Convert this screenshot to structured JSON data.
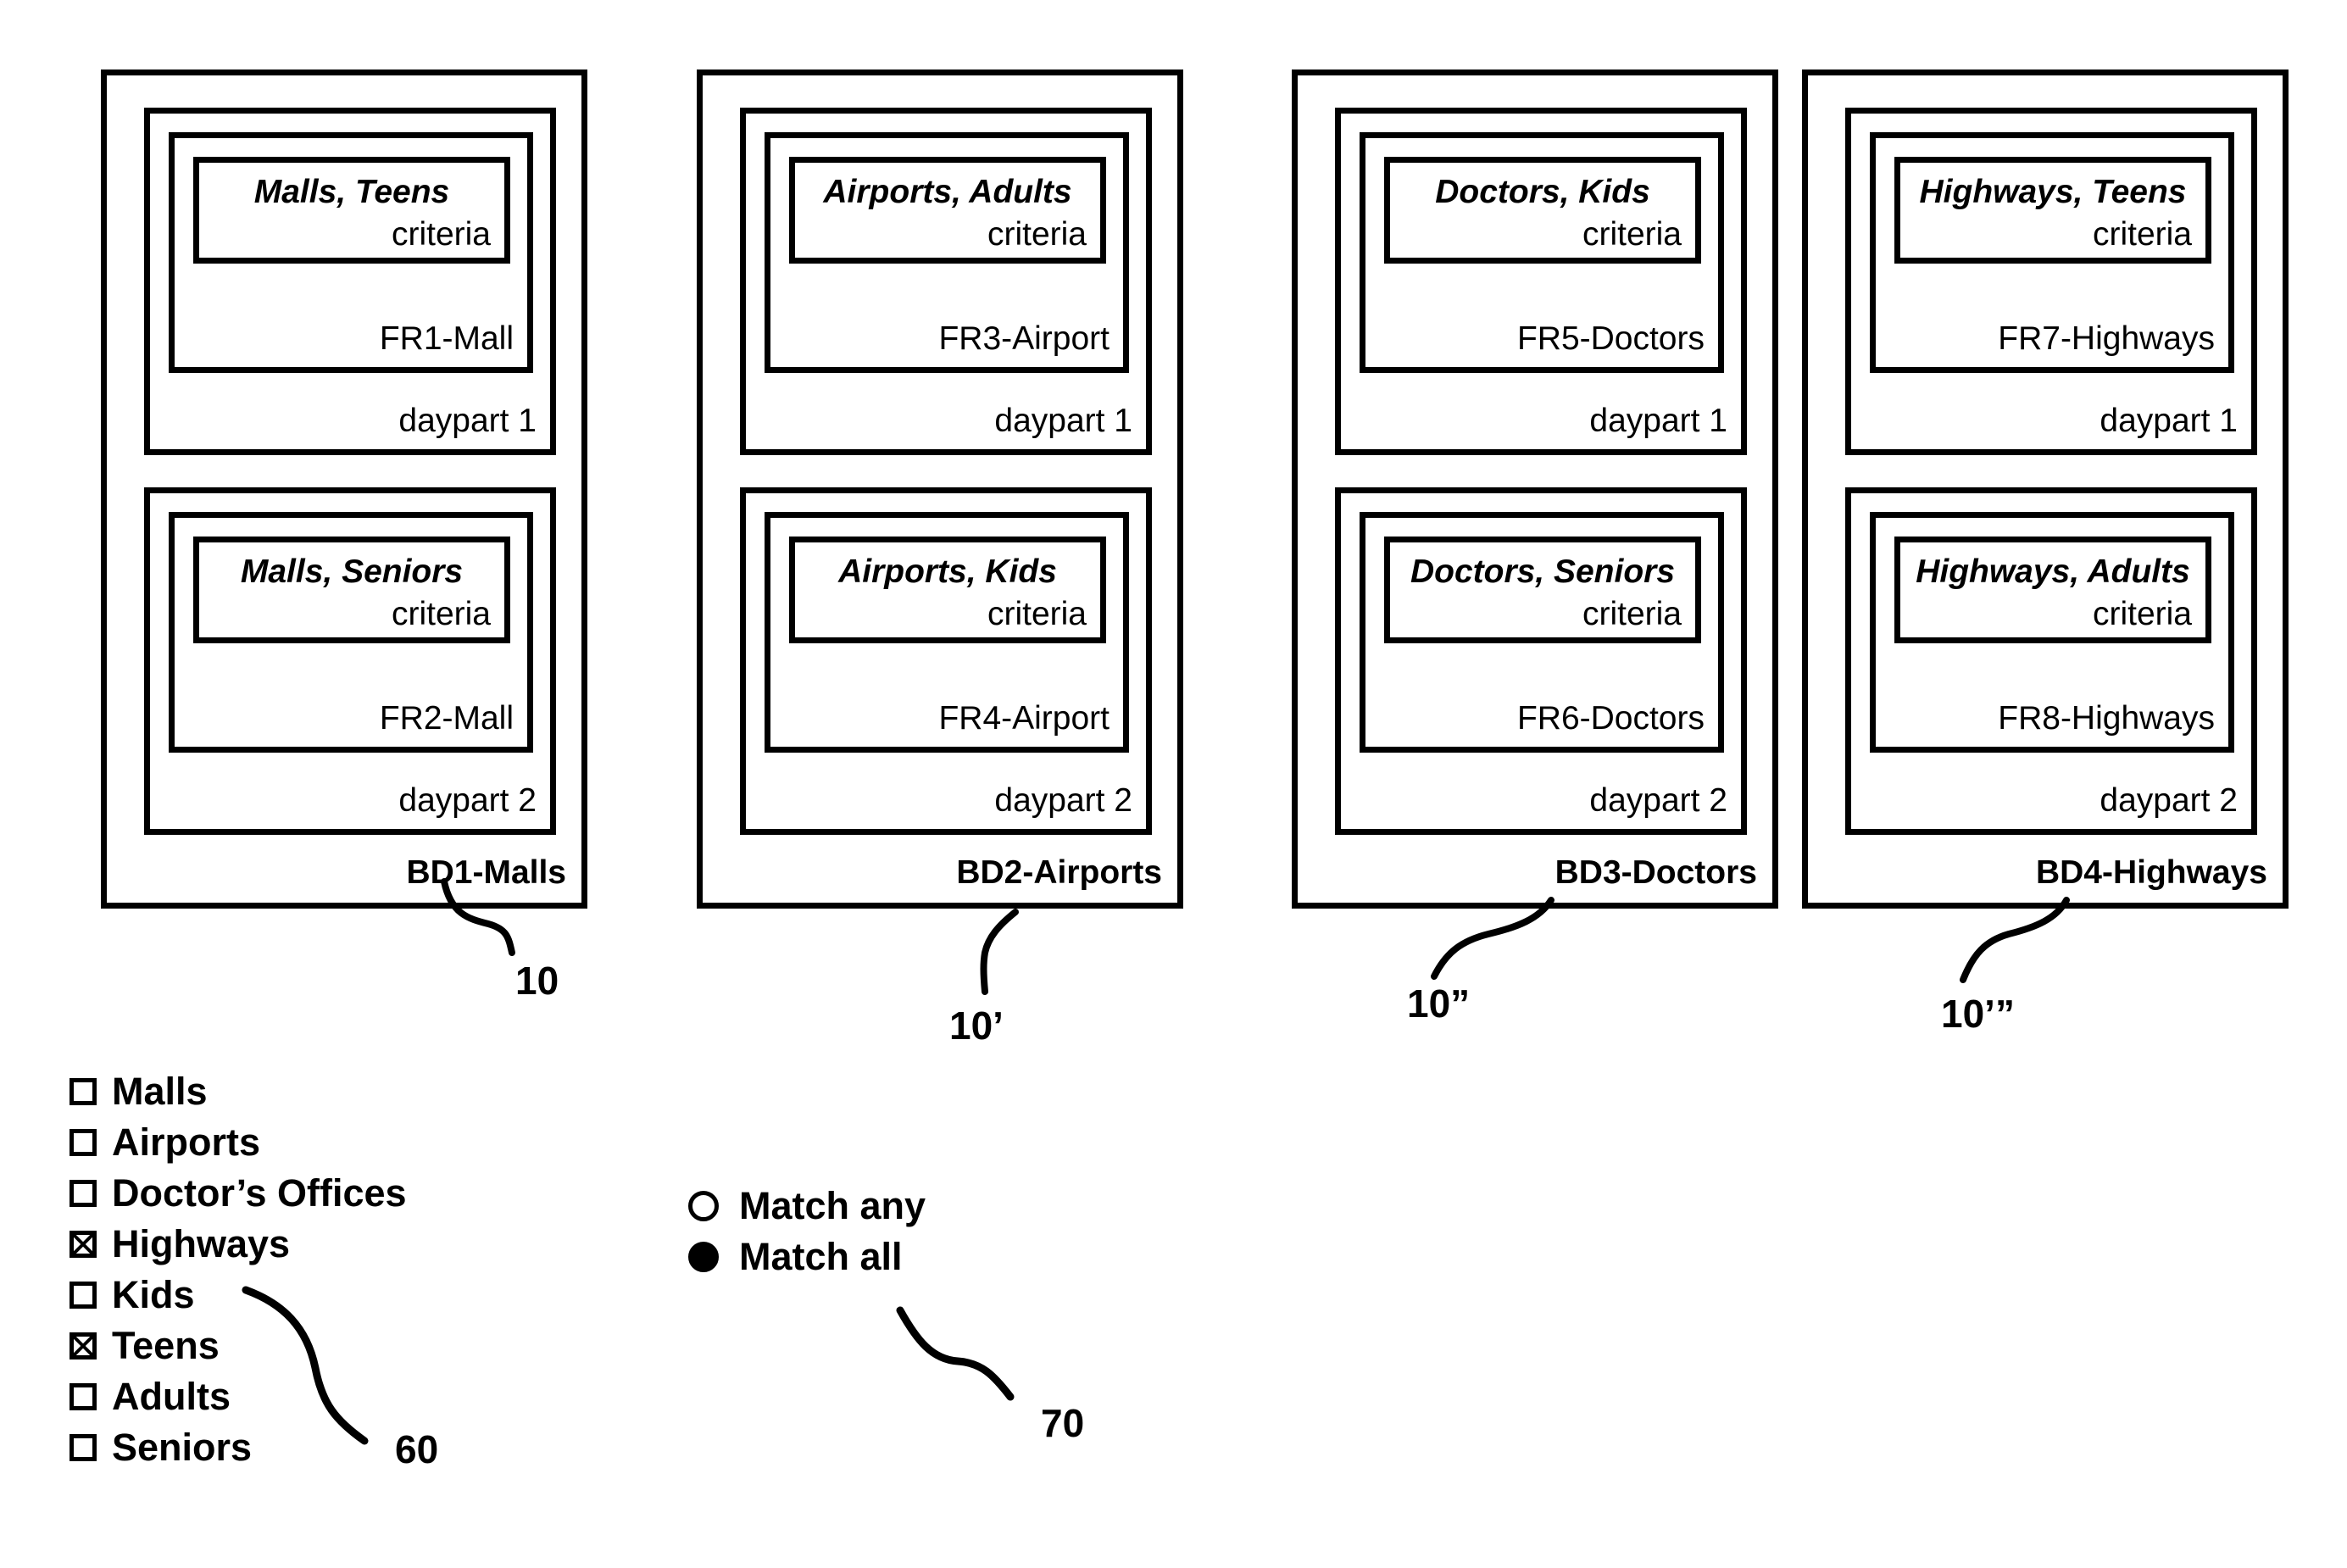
{
  "diagram": {
    "business_definitions": [
      {
        "bd_label": "BD1-Malls",
        "ref": "10",
        "dayparts": [
          {
            "dp_label": "daypart 1",
            "fr_label": "FR1-Mall",
            "criteria_title": "Malls, Teens",
            "criteria_label": "criteria"
          },
          {
            "dp_label": "daypart 2",
            "fr_label": "FR2-Mall",
            "criteria_title": "Malls, Seniors",
            "criteria_label": "criteria"
          }
        ]
      },
      {
        "bd_label": "BD2-Airports",
        "ref": "10’",
        "dayparts": [
          {
            "dp_label": "daypart 1",
            "fr_label": "FR3-Airport",
            "criteria_title": "Airports, Adults",
            "criteria_label": "criteria"
          },
          {
            "dp_label": "daypart 2",
            "fr_label": "FR4-Airport",
            "criteria_title": "Airports, Kids",
            "criteria_label": "criteria"
          }
        ]
      },
      {
        "bd_label": "BD3-Doctors",
        "ref": "10”",
        "dayparts": [
          {
            "dp_label": "daypart 1",
            "fr_label": "FR5-Doctors",
            "criteria_title": "Doctors, Kids",
            "criteria_label": "criteria"
          },
          {
            "dp_label": "daypart 2",
            "fr_label": "FR6-Doctors",
            "criteria_title": "Doctors, Seniors",
            "criteria_label": "criteria"
          }
        ]
      },
      {
        "bd_label": "BD4-Highways",
        "ref": "10’”",
        "dayparts": [
          {
            "dp_label": "daypart 1",
            "fr_label": "FR7-Highways",
            "criteria_title": "Highways, Teens",
            "criteria_label": "criteria"
          },
          {
            "dp_label": "daypart 2",
            "fr_label": "FR8-Highways",
            "criteria_title": "Highways, Adults",
            "criteria_label": "criteria"
          }
        ]
      }
    ]
  },
  "checkbox_panel": {
    "ref": "60",
    "items": [
      {
        "label": "Malls",
        "checked": false
      },
      {
        "label": "Airports",
        "checked": false
      },
      {
        "label": "Doctor’s Offices",
        "checked": false
      },
      {
        "label": "Highways",
        "checked": true
      },
      {
        "label": "Kids",
        "checked": false
      },
      {
        "label": "Teens",
        "checked": true
      },
      {
        "label": "Adults",
        "checked": false
      },
      {
        "label": "Seniors",
        "checked": false
      }
    ]
  },
  "radio_panel": {
    "ref": "70",
    "items": [
      {
        "label": "Match any",
        "selected": false
      },
      {
        "label": "Match all",
        "selected": true
      }
    ]
  },
  "colors": {
    "ink": "#000000",
    "paper": "#ffffff"
  }
}
